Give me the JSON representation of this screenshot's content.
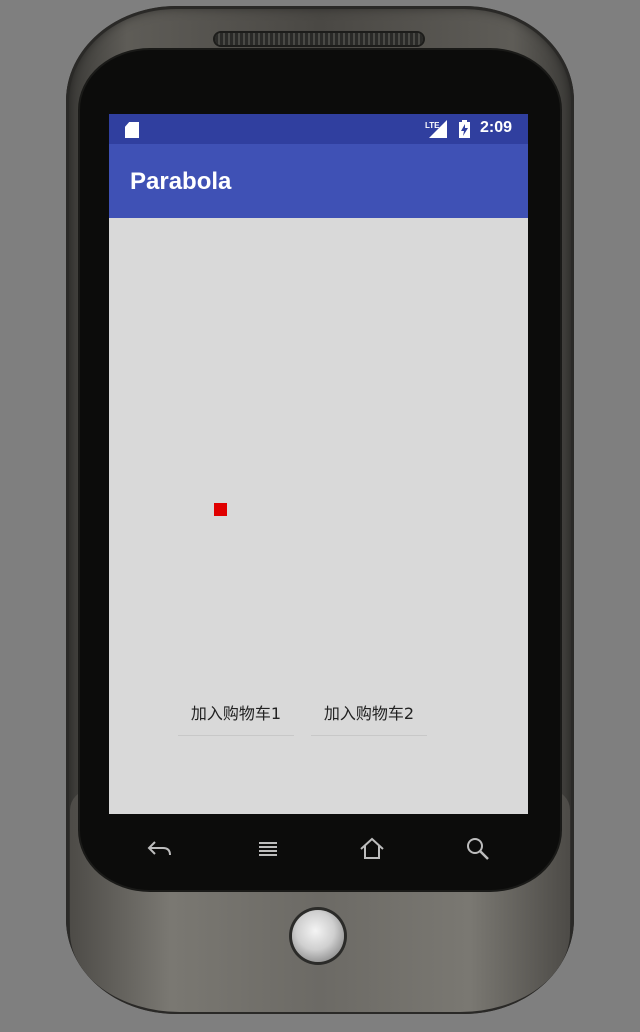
{
  "status_bar": {
    "time": "2:09",
    "icons": [
      "sd-card-icon",
      "lte-signal-icon",
      "battery-charging-icon"
    ],
    "color": "#303f9f"
  },
  "app_bar": {
    "title": "Parabola",
    "color": "#3f51b5"
  },
  "content": {
    "background": "#d9d9d9",
    "animated_item_color": "#e00000",
    "buttons": [
      {
        "label": "加入购物车1"
      },
      {
        "label": "加入购物车2"
      }
    ]
  },
  "nav_bar": {
    "icons": [
      "back-icon",
      "menu-icon",
      "home-icon",
      "search-icon"
    ]
  }
}
